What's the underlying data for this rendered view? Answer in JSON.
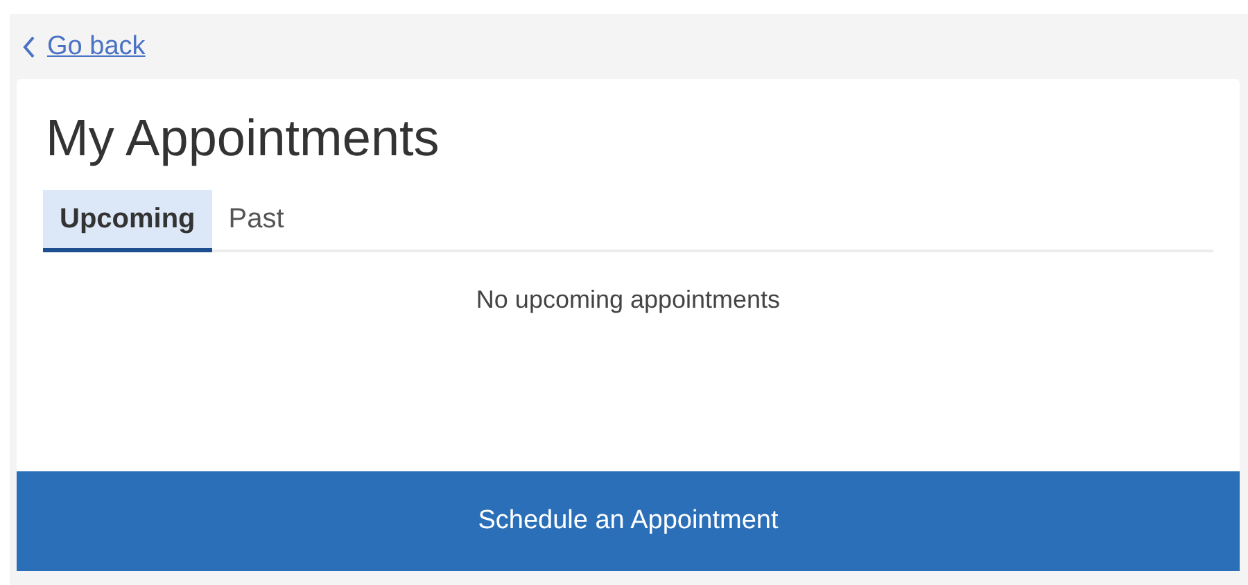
{
  "back_link": {
    "label": "Go back"
  },
  "title": "My Appointments",
  "tabs": [
    {
      "label": "Upcoming",
      "selected": true
    },
    {
      "label": "Past",
      "selected": false
    }
  ],
  "empty_message": "No upcoming appointments",
  "primary_button": {
    "label": "Schedule an Appointment"
  }
}
